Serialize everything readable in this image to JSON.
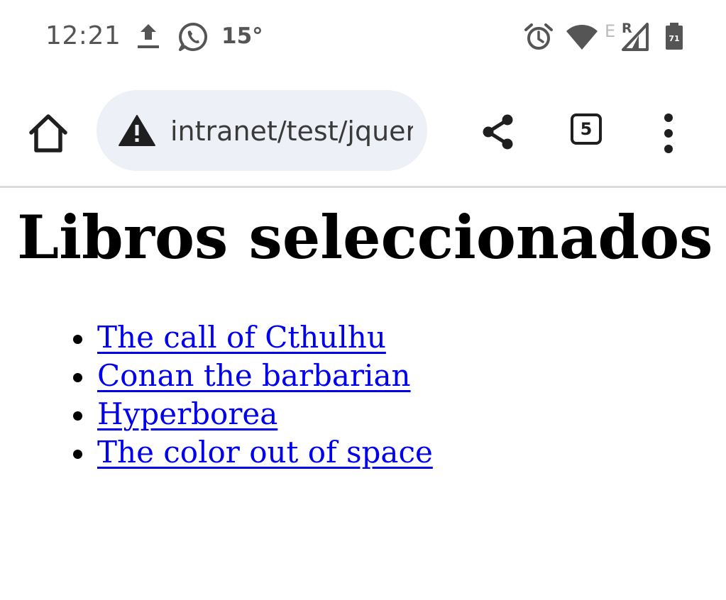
{
  "status_bar": {
    "time": "12:21",
    "temperature": "15°",
    "icons": [
      "upload-icon",
      "whatsapp-icon",
      "alarm-icon",
      "wifi-icon",
      "signal-icon",
      "battery-icon"
    ],
    "network_type": "E",
    "roaming": "R",
    "battery_level": "71"
  },
  "browser": {
    "url": "intranet/test/jquery",
    "security_icon": "warning-icon",
    "tab_count": "5",
    "toolbar_icons": [
      "home-icon",
      "share-icon",
      "tabs-icon",
      "more-vert-icon"
    ]
  },
  "page": {
    "heading": "Libros seleccionados",
    "books": [
      "The call of Cthulhu",
      "Conan the barbarian",
      "Hyperborea",
      "The color out of space"
    ],
    "link_color": "#0000ee"
  },
  "colors": {
    "status_text": "#555555",
    "url_bar_bg": "#edf0f7",
    "icon_dark": "#1f1f1f"
  }
}
